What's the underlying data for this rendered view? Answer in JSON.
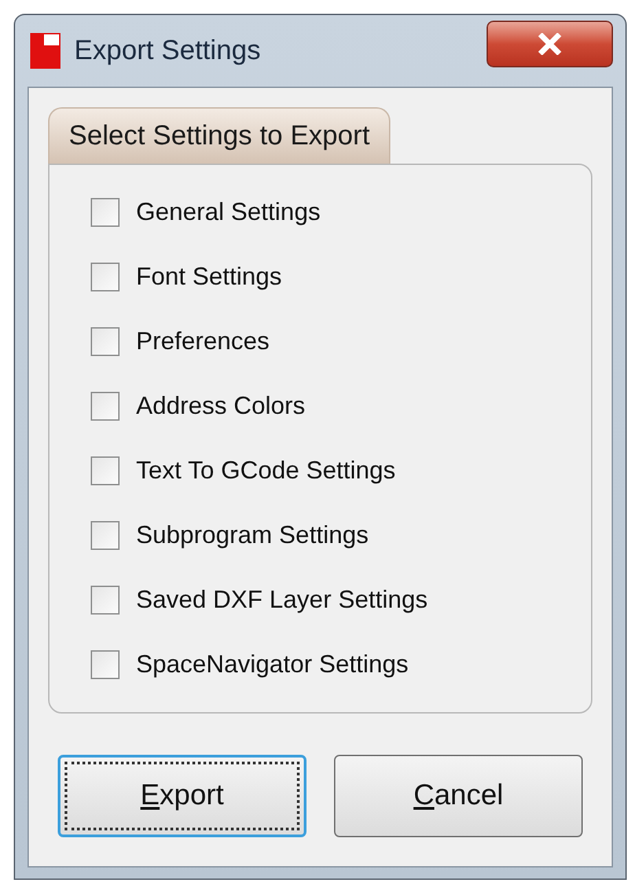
{
  "window": {
    "title": "Export Settings"
  },
  "group": {
    "title": "Select Settings to Export"
  },
  "options": [
    {
      "label": "General Settings",
      "checked": false
    },
    {
      "label": "Font Settings",
      "checked": false
    },
    {
      "label": "Preferences",
      "checked": false
    },
    {
      "label": "Address Colors",
      "checked": false
    },
    {
      "label": "Text To GCode Settings",
      "checked": false
    },
    {
      "label": "Subprogram Settings",
      "checked": false
    },
    {
      "label": "Saved DXF Layer Settings",
      "checked": false
    },
    {
      "label": "SpaceNavigator Settings",
      "checked": false
    }
  ],
  "buttons": [
    {
      "label": "Export",
      "focused": true
    },
    {
      "label": "Cancel",
      "focused": false
    }
  ]
}
